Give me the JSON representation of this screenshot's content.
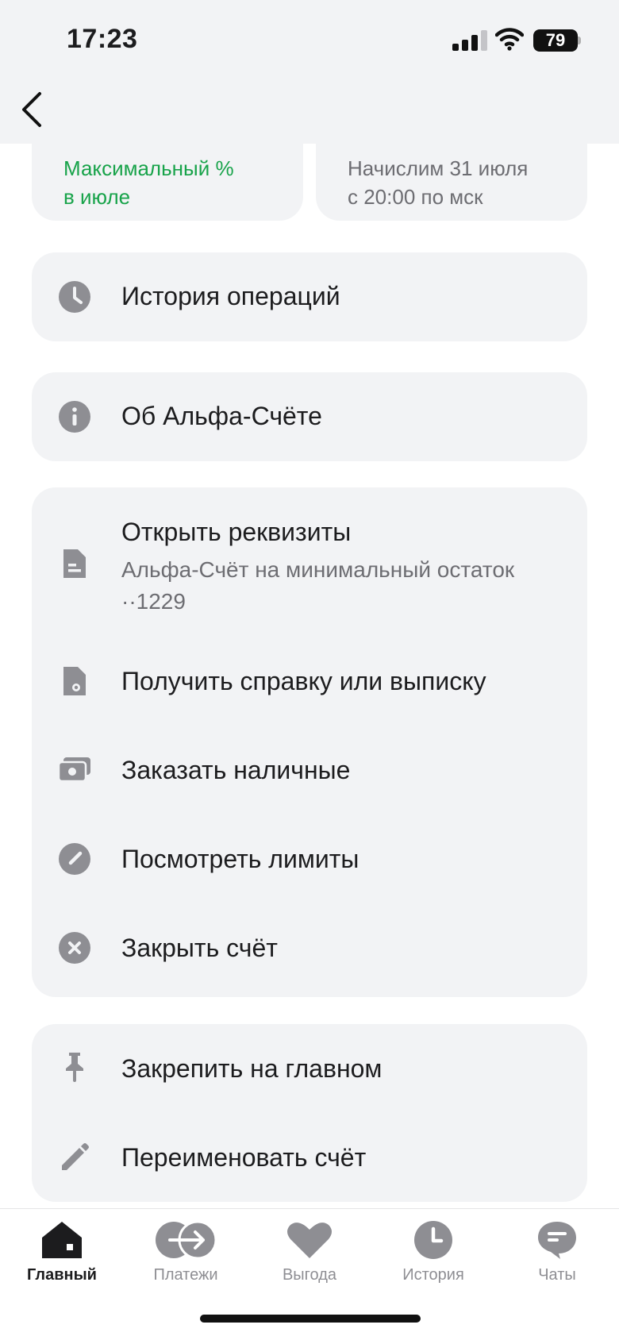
{
  "status": {
    "time": "17:23",
    "battery": "79"
  },
  "info_cards": {
    "left": {
      "line1": "Максимальный %",
      "line2": "в июле"
    },
    "right": {
      "line1": "Начислим 31 июля",
      "line2": "с 20:00 по мск"
    }
  },
  "menu": {
    "history": "История операций",
    "about": "Об Альфа-Счёте",
    "requisites": {
      "label": "Открыть реквизиты",
      "sub1": "Альфа-Счёт на минимальный остаток",
      "sub2": "··1229"
    },
    "statement": "Получить справку или выписку",
    "cash": "Заказать наличные",
    "limits": "Посмотреть лимиты",
    "close": "Закрыть счёт",
    "pin": "Закрепить на главном",
    "rename": "Переименовать счёт"
  },
  "tabs": [
    "Главный",
    "Платежи",
    "Выгода",
    "История",
    "Чаты"
  ],
  "colors": {
    "accent_green": "#18a34a",
    "card_bg": "#f2f3f5",
    "icon_gray": "#8e8e93"
  }
}
